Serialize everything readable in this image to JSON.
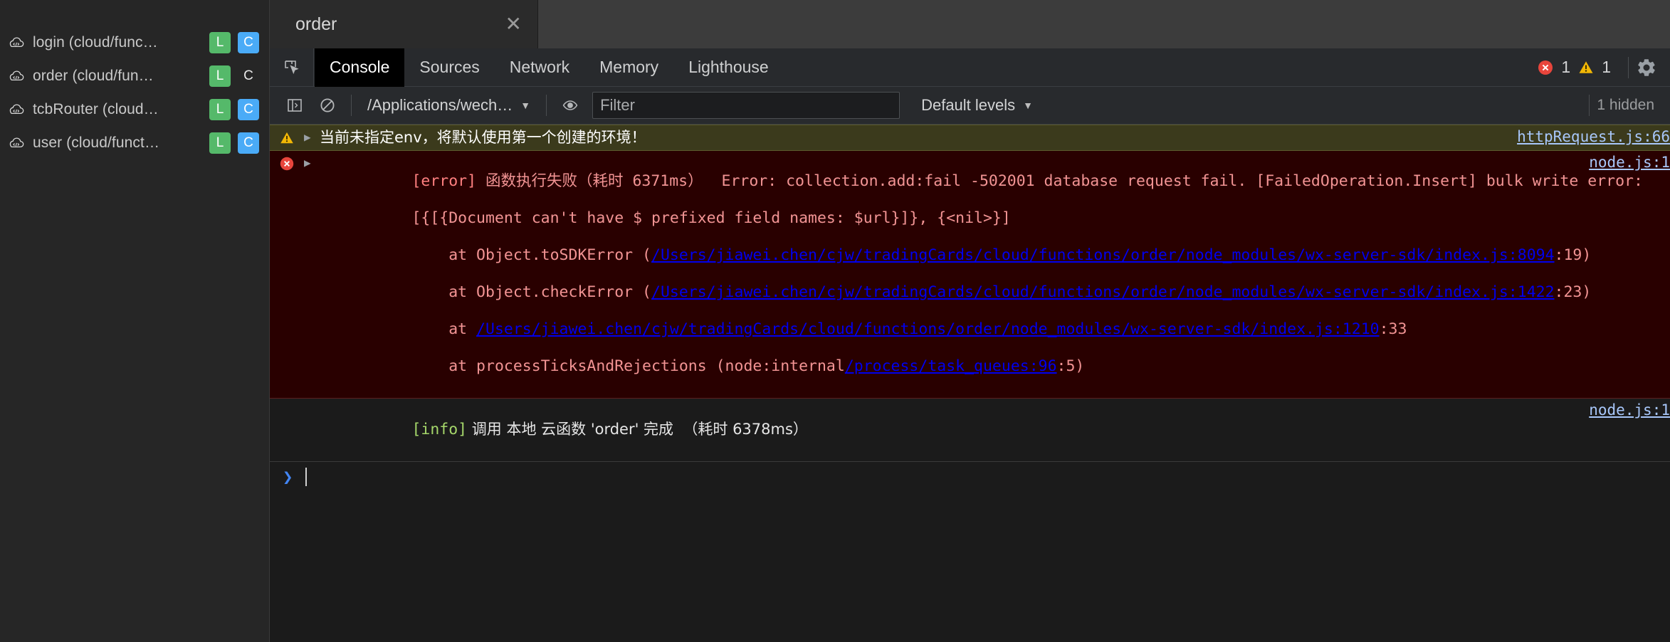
{
  "sidebar": {
    "items": [
      {
        "icon": "cloud-code-icon",
        "label": "login (cloud/func…",
        "local_badge": "L",
        "cloud_badge": "C",
        "cloud_active": true
      },
      {
        "icon": "cloud-code-icon",
        "label": "order (cloud/fun…",
        "local_badge": "L",
        "cloud_badge": "C",
        "cloud_active": false
      },
      {
        "icon": "cloud-code-icon",
        "label": "tcbRouter (cloud…",
        "local_badge": "L",
        "cloud_badge": "C",
        "cloud_active": true
      },
      {
        "icon": "cloud-code-icon",
        "label": "user (cloud/funct…",
        "local_badge": "L",
        "cloud_badge": "C",
        "cloud_active": true
      }
    ]
  },
  "window_tab": {
    "title": "order",
    "close_label": "✕"
  },
  "devtools": {
    "inspect_icon": "inspect-element-icon",
    "tabs": [
      {
        "label": "Console",
        "active": true
      },
      {
        "label": "Sources",
        "active": false
      },
      {
        "label": "Network",
        "active": false
      },
      {
        "label": "Memory",
        "active": false
      },
      {
        "label": "Lighthouse",
        "active": false
      }
    ],
    "error_count": "1",
    "warning_count": "1",
    "settings_icon": "gear-icon"
  },
  "console_toolbar": {
    "sidebar_toggle_icon": "console-sidebar-icon",
    "clear_icon": "clear-console-icon",
    "context_selector": "/Applications/wech…",
    "eye_icon": "live-expression-icon",
    "filter_placeholder": "Filter",
    "filter_value": "",
    "levels_label": "Default levels",
    "hidden_label": "1 hidden"
  },
  "console_messages": [
    {
      "type": "warning",
      "icon": "warning-triangle-icon",
      "expand_arrow": "▶",
      "text": "当前未指定env，将默认使用第一个创建的环境！",
      "source": "httpRequest.js:66"
    },
    {
      "type": "error",
      "icon": "error-circle-icon",
      "expand_arrow": "▶",
      "tag": "[error]",
      "line1": " 函数执行失败（耗时 6371ms）  Error: collection.add:fail -502001 database request fail. [FailedOperation.Insert] bulk write error:",
      "line2": "[{[{Document can't have $ prefixed field names: $url}]}, {<nil>}]",
      "stack": [
        {
          "prefix": "    at Object.toSDKError (",
          "link": "/Users/jiawei.chen/cjw/tradingCards/cloud/functions/order/node_modules/wx-server-sdk/index.js:8094",
          "suffix": ":19)"
        },
        {
          "prefix": "    at Object.checkError (",
          "link": "/Users/jiawei.chen/cjw/tradingCards/cloud/functions/order/node_modules/wx-server-sdk/index.js:1422",
          "suffix": ":23)"
        },
        {
          "prefix": "    at ",
          "link": "/Users/jiawei.chen/cjw/tradingCards/cloud/functions/order/node_modules/wx-server-sdk/index.js:1210",
          "suffix": ":33"
        },
        {
          "prefix": "    at processTicksAndRejections (node:internal",
          "link": "/process/task_queues:96",
          "suffix": ":5)"
        }
      ],
      "source": "node.js:1"
    },
    {
      "type": "info",
      "tag": "[info]",
      "text": " 调用 本地 云函数 'order' 完成  （耗时 6378ms）",
      "source": "node.js:1"
    }
  ],
  "prompt": {
    "caret": "❯"
  },
  "colors": {
    "green_badge": "#55b96a",
    "blue_badge": "#4aabf7",
    "error_red": "#f29494",
    "warn_bg": "#3b3a1c",
    "error_bg": "#290000",
    "link_blue": "#a8c7fa",
    "info_green": "#a5d76a"
  }
}
